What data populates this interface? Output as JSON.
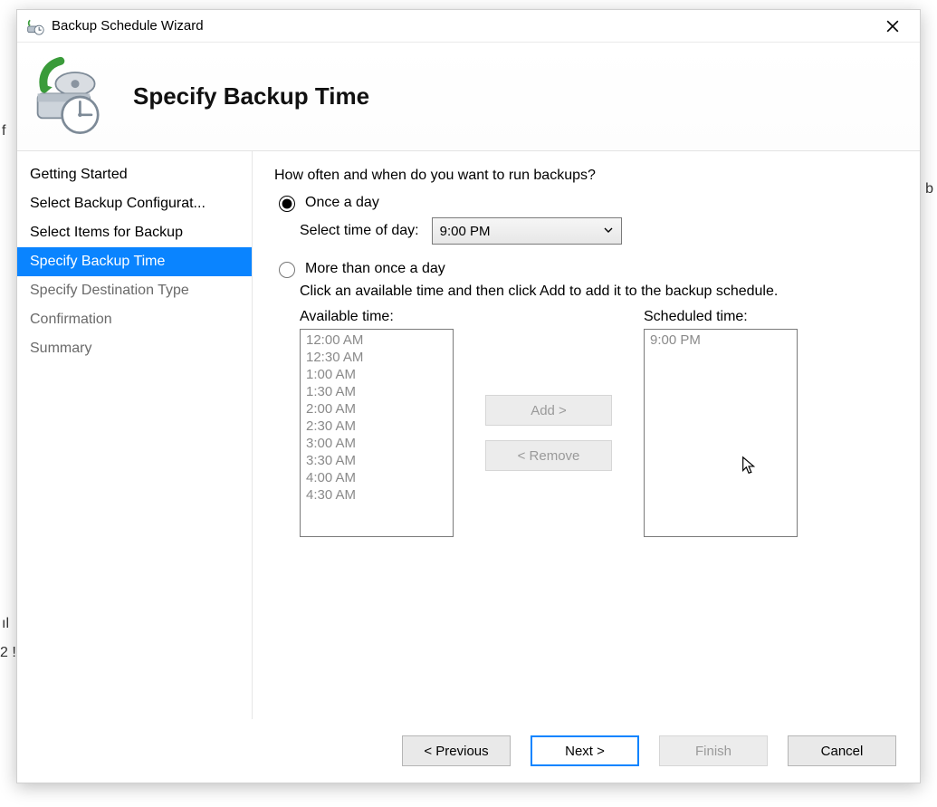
{
  "window": {
    "title": "Backup Schedule Wizard"
  },
  "header": {
    "title": "Specify Backup Time"
  },
  "sidebar": {
    "steps": [
      {
        "label": "Getting Started",
        "state": "past"
      },
      {
        "label": "Select Backup Configurat...",
        "state": "past"
      },
      {
        "label": "Select Items for Backup",
        "state": "past"
      },
      {
        "label": "Specify Backup Time",
        "state": "active"
      },
      {
        "label": "Specify Destination Type",
        "state": "future"
      },
      {
        "label": "Confirmation",
        "state": "future"
      },
      {
        "label": "Summary",
        "state": "future"
      }
    ]
  },
  "main": {
    "question": "How often and when do you want to run backups?",
    "once": {
      "label": "Once a day",
      "checked": true,
      "select_label": "Select time of day:",
      "selected_time": "9:00 PM"
    },
    "more": {
      "label": "More than once a day",
      "checked": false,
      "hint": "Click an available time and then click Add to add it to the backup schedule.",
      "available_label": "Available time:",
      "scheduled_label": "Scheduled time:",
      "available_times": [
        "12:00 AM",
        "12:30 AM",
        "1:00 AM",
        "1:30 AM",
        "2:00 AM",
        "2:30 AM",
        "3:00 AM",
        "3:30 AM",
        "4:00 AM",
        "4:30 AM"
      ],
      "scheduled_times": [
        "9:00 PM"
      ],
      "add_label": "Add >",
      "remove_label": "< Remove"
    }
  },
  "footer": {
    "previous": "< Previous",
    "next": "Next >",
    "finish": "Finish",
    "cancel": "Cancel"
  }
}
